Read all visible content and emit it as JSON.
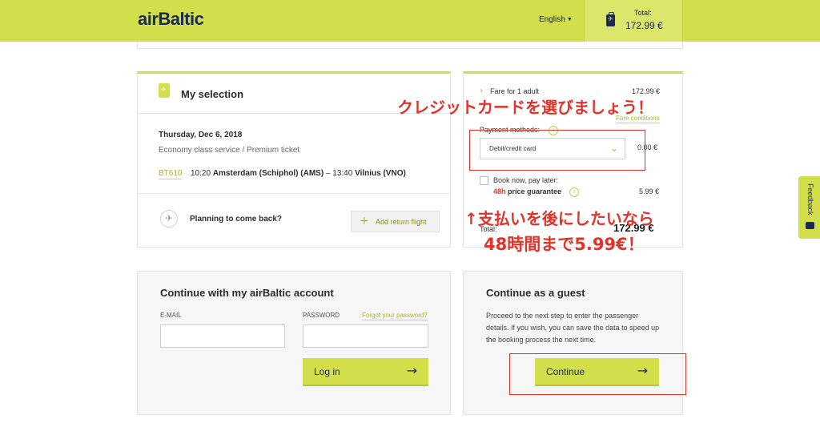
{
  "header": {
    "logo": "airBaltic",
    "language": "English",
    "total_label": "Total:",
    "total_value": "172.99 €",
    "accent_color": "#d2df4a"
  },
  "selection": {
    "title": "My selection",
    "date": "Thursday, Dec 6, 2018",
    "service": "Economy class service / Premium ticket",
    "flight_number": "BT610",
    "departure_time": "10:20",
    "departure_airport": "Amsterdam (Schiphol) (AMS)",
    "dash": "–",
    "arrival_time": "13:40",
    "arrival_airport": "Vilnius (VNO)",
    "return_question": "Planning to come back?",
    "add_return_label": "Add return flight"
  },
  "fare": {
    "fare_label": "Fare for 1 adult",
    "fare_value": "172.99 €",
    "fare_conditions": "Fare conditions",
    "payment_label": "Payment methods:",
    "payment_selected": "Debit/credit card",
    "payment_fee": "0.00 €",
    "book_later_label": "Book now, pay later:",
    "guarantee_hours": "48h",
    "guarantee_text": "price guarantee",
    "guarantee_value": "5.99 €",
    "total_label": "Total:",
    "total_value": "172.99 €"
  },
  "account": {
    "title": "Continue with my airBaltic account",
    "email_label": "E-MAIL",
    "password_label": "PASSWORD",
    "forgot_link": "Forgot your password?",
    "login_button": "Log in"
  },
  "guest": {
    "title": "Continue as a guest",
    "line1": "Proceed to the next step to enter the passenger",
    "line2": "details. If you wish, you can save the data to speed up",
    "line3": "the booking process the next time.",
    "continue_button": "Continue"
  },
  "annotations": {
    "credit_card": "クレジットカードを選びましょう！",
    "pay_later_line1": "↑支払いを後にしたいなら",
    "pay_later_line2": "48時間まで5.99€！",
    "color": "#e2332a"
  },
  "feedback": {
    "label": "Feedback"
  }
}
